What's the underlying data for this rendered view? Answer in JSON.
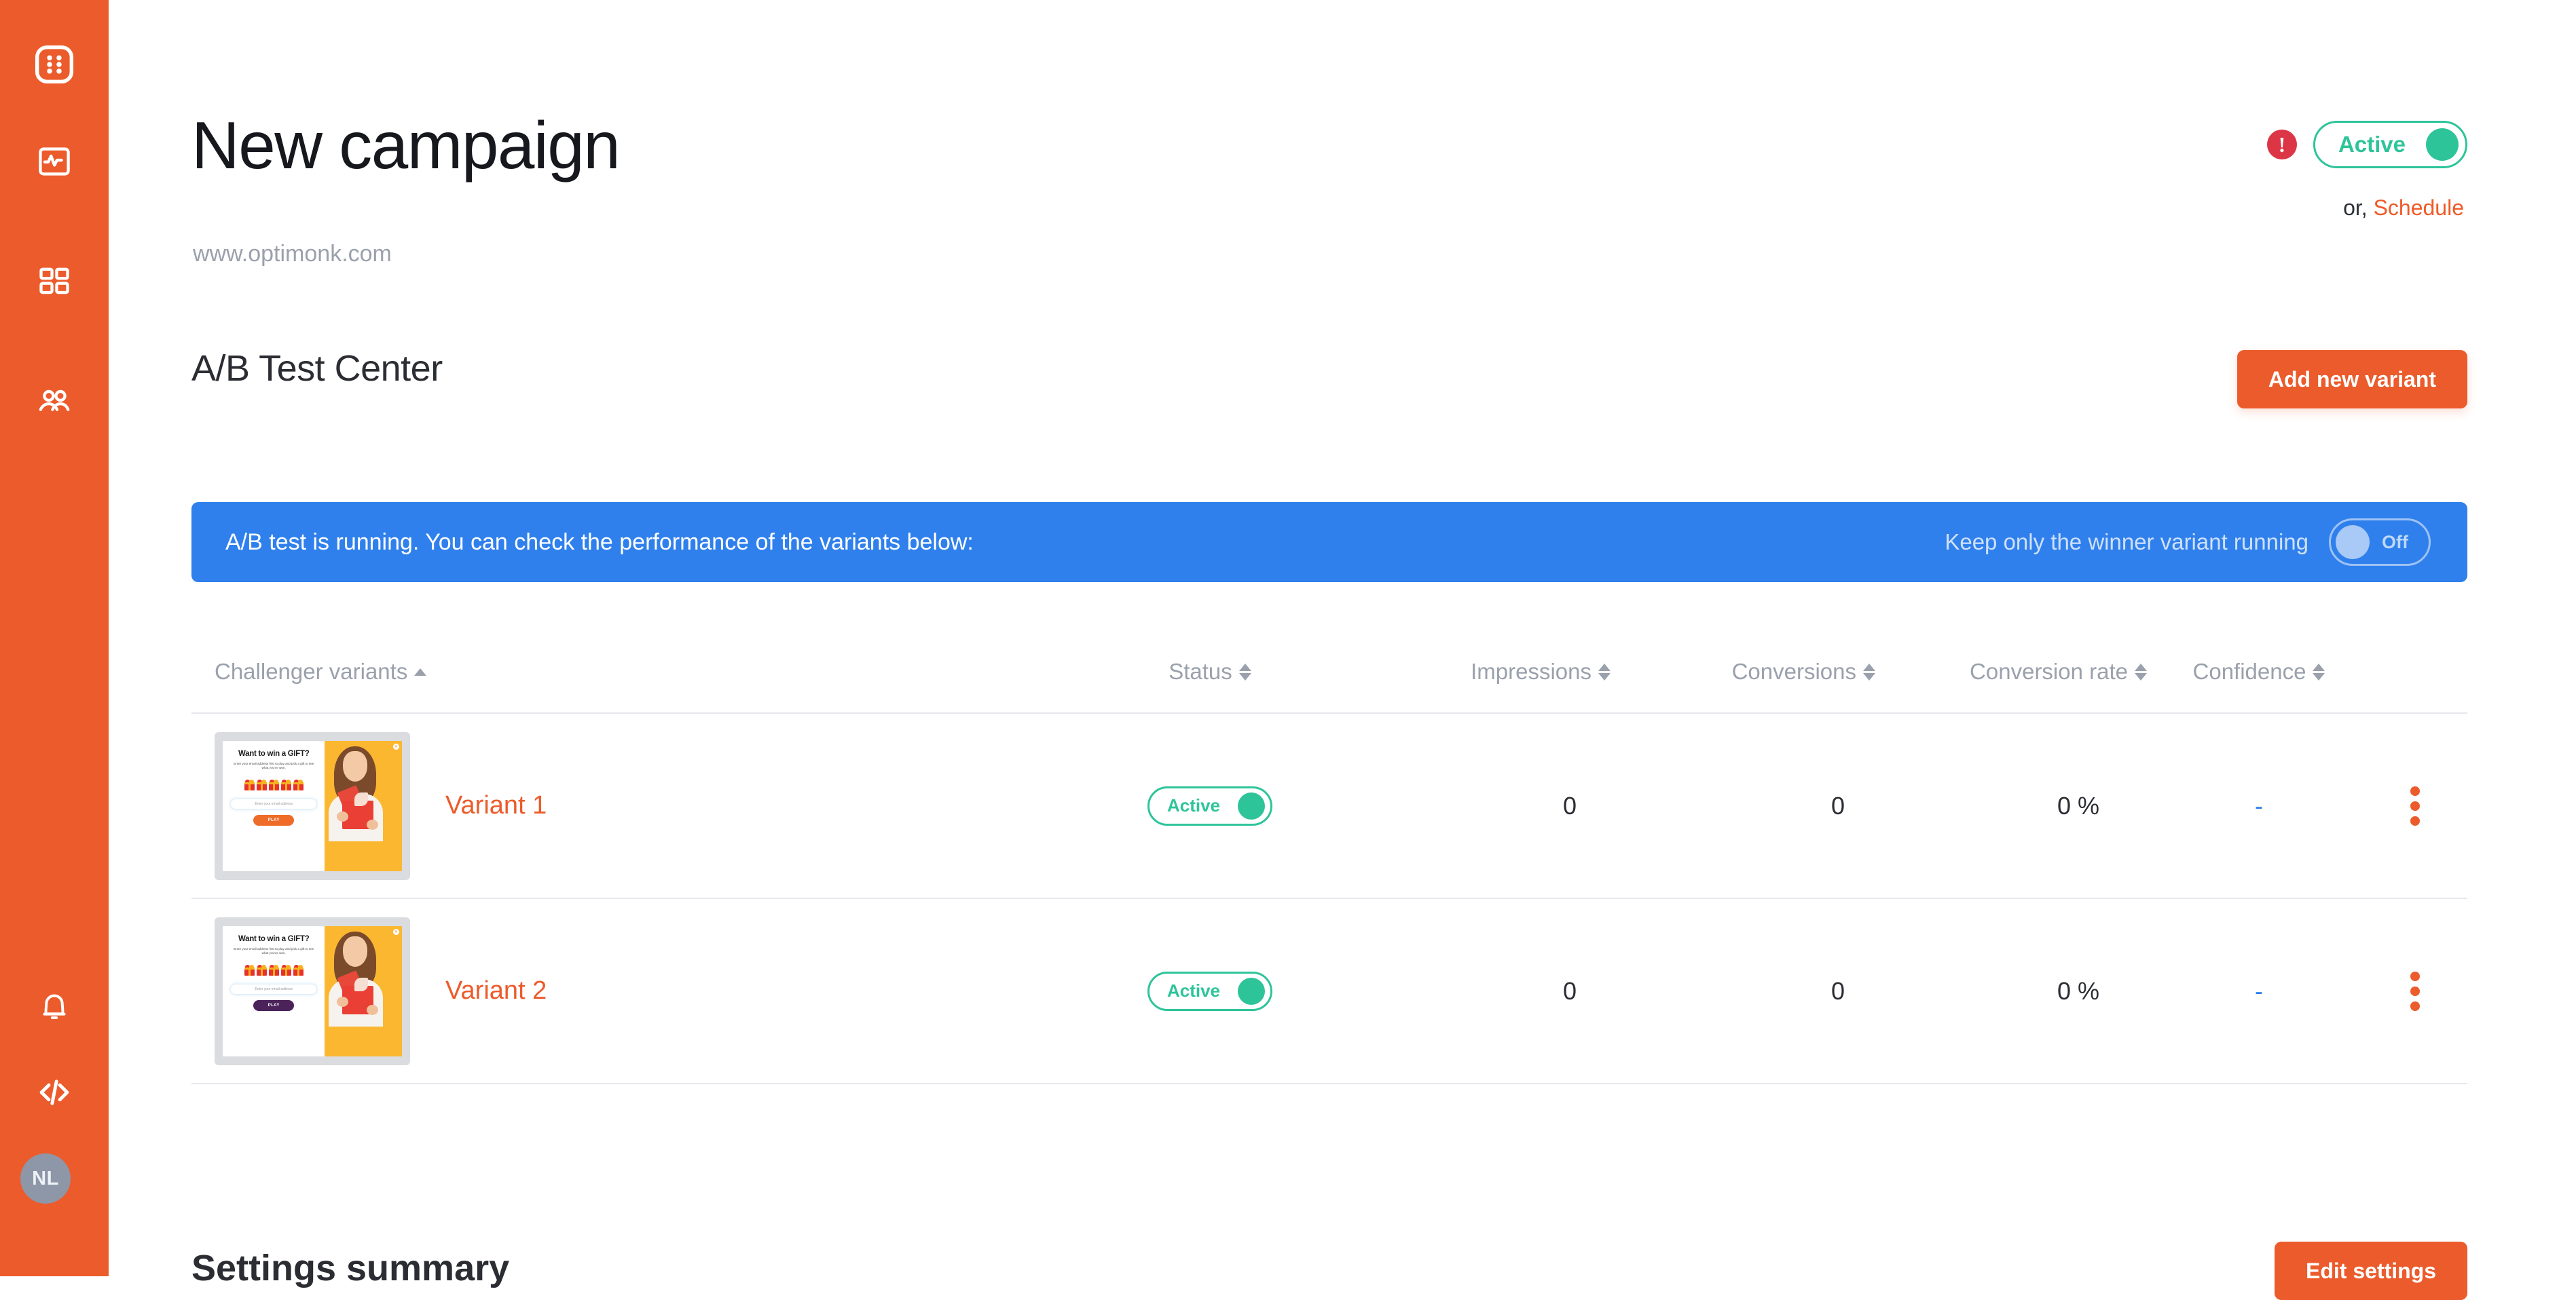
{
  "sidebar": {
    "logo_icon": "optimonk-grid-logo-icon",
    "items": [
      {
        "icon": "analytics-pulse-icon",
        "name": "analytics"
      },
      {
        "icon": "grid-squares-icon",
        "name": "campaigns"
      },
      {
        "icon": "users-icon",
        "name": "audience"
      }
    ],
    "bottom_items": [
      {
        "icon": "bell-icon",
        "name": "notifications"
      },
      {
        "icon": "code-icon",
        "name": "embed-code"
      }
    ],
    "avatar_initials": "NL"
  },
  "header": {
    "title": "New campaign",
    "url": "www.optimonk.com",
    "alert_icon": "exclamation-circle-icon",
    "status_toggle": {
      "label": "Active",
      "state": "on"
    },
    "or_prefix": "or,",
    "schedule_link": "Schedule"
  },
  "section": {
    "title": "A/B Test Center",
    "add_variant_label": "Add new variant"
  },
  "banner": {
    "message": "A/B test is running. You can check the performance of the variants below:",
    "keep_winner_label": "Keep only the winner variant running",
    "keep_winner_toggle": {
      "label": "Off",
      "state": "off"
    }
  },
  "table": {
    "columns": [
      {
        "label": "Challenger variants",
        "sort": "asc"
      },
      {
        "label": "Status",
        "sort": "none"
      },
      {
        "label": "Impressions",
        "sort": "none"
      },
      {
        "label": "Conversions",
        "sort": "none"
      },
      {
        "label": "Conversion rate",
        "sort": "none"
      },
      {
        "label": "Confidence",
        "sort": "none"
      }
    ],
    "rows": [
      {
        "name": "Variant 1",
        "status": "Active",
        "impressions": "0",
        "conversions": "0",
        "conversion_rate": "0 %",
        "confidence": "-",
        "menu_icon": "kebab-menu-icon",
        "preview": {
          "title": "Want to win a GIFT?",
          "description": "Enter your email address first to play and pick a gift to see what you've won.",
          "input_placeholder": "Enter your email address",
          "button_label": "PLAY",
          "button_color": "#ef6b28",
          "close_icon": "close-icon"
        }
      },
      {
        "name": "Variant 2",
        "status": "Active",
        "impressions": "0",
        "conversions": "0",
        "conversion_rate": "0 %",
        "confidence": "-",
        "menu_icon": "kebab-menu-icon",
        "preview": {
          "title": "Want to win a GIFT?",
          "description": "Enter your email address first to play and pick a gift to see what you've won.",
          "input_placeholder": "Enter your email address",
          "button_label": "PLAY",
          "button_color": "#4b2259",
          "close_icon": "close-icon"
        }
      }
    ]
  },
  "footer": {
    "settings_summary_title": "Settings summary",
    "edit_settings_label": "Edit settings"
  },
  "colors": {
    "brand_orange": "#ec5b2b",
    "banner_blue": "#2f80ec",
    "active_green": "#2ec49a",
    "alert_red": "#dc3545"
  }
}
